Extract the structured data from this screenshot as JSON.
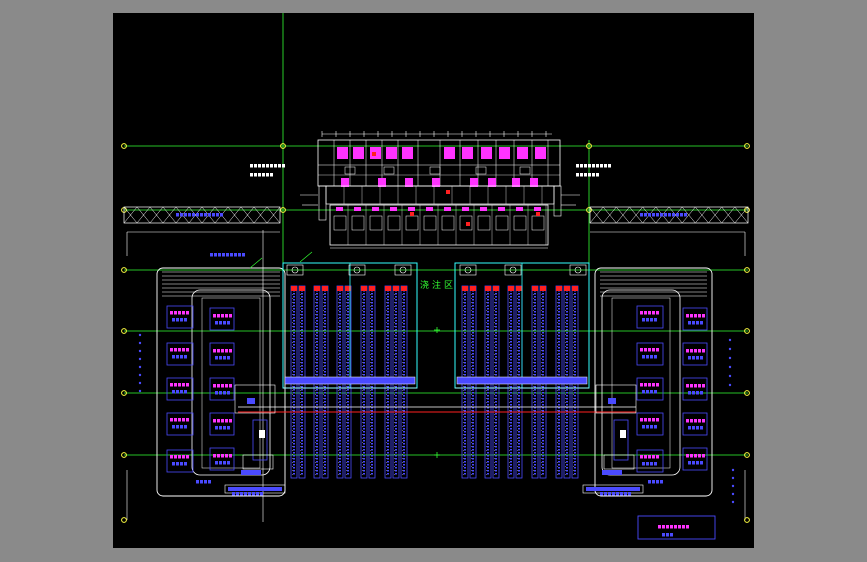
{
  "viewer": {
    "background": "#8a8a8a",
    "canvas": "#000000"
  },
  "colors": {
    "grid": "#33ff33",
    "outline": "#ffffff",
    "equipment": "#ff33ff",
    "conveyor": "#4a4aff",
    "cyan": "#33ffff",
    "accent_red": "#ff2020",
    "bubble": "#ffff40",
    "label_green": "#33ff33"
  },
  "labels": {
    "casting_area": "浇注区"
  }
}
